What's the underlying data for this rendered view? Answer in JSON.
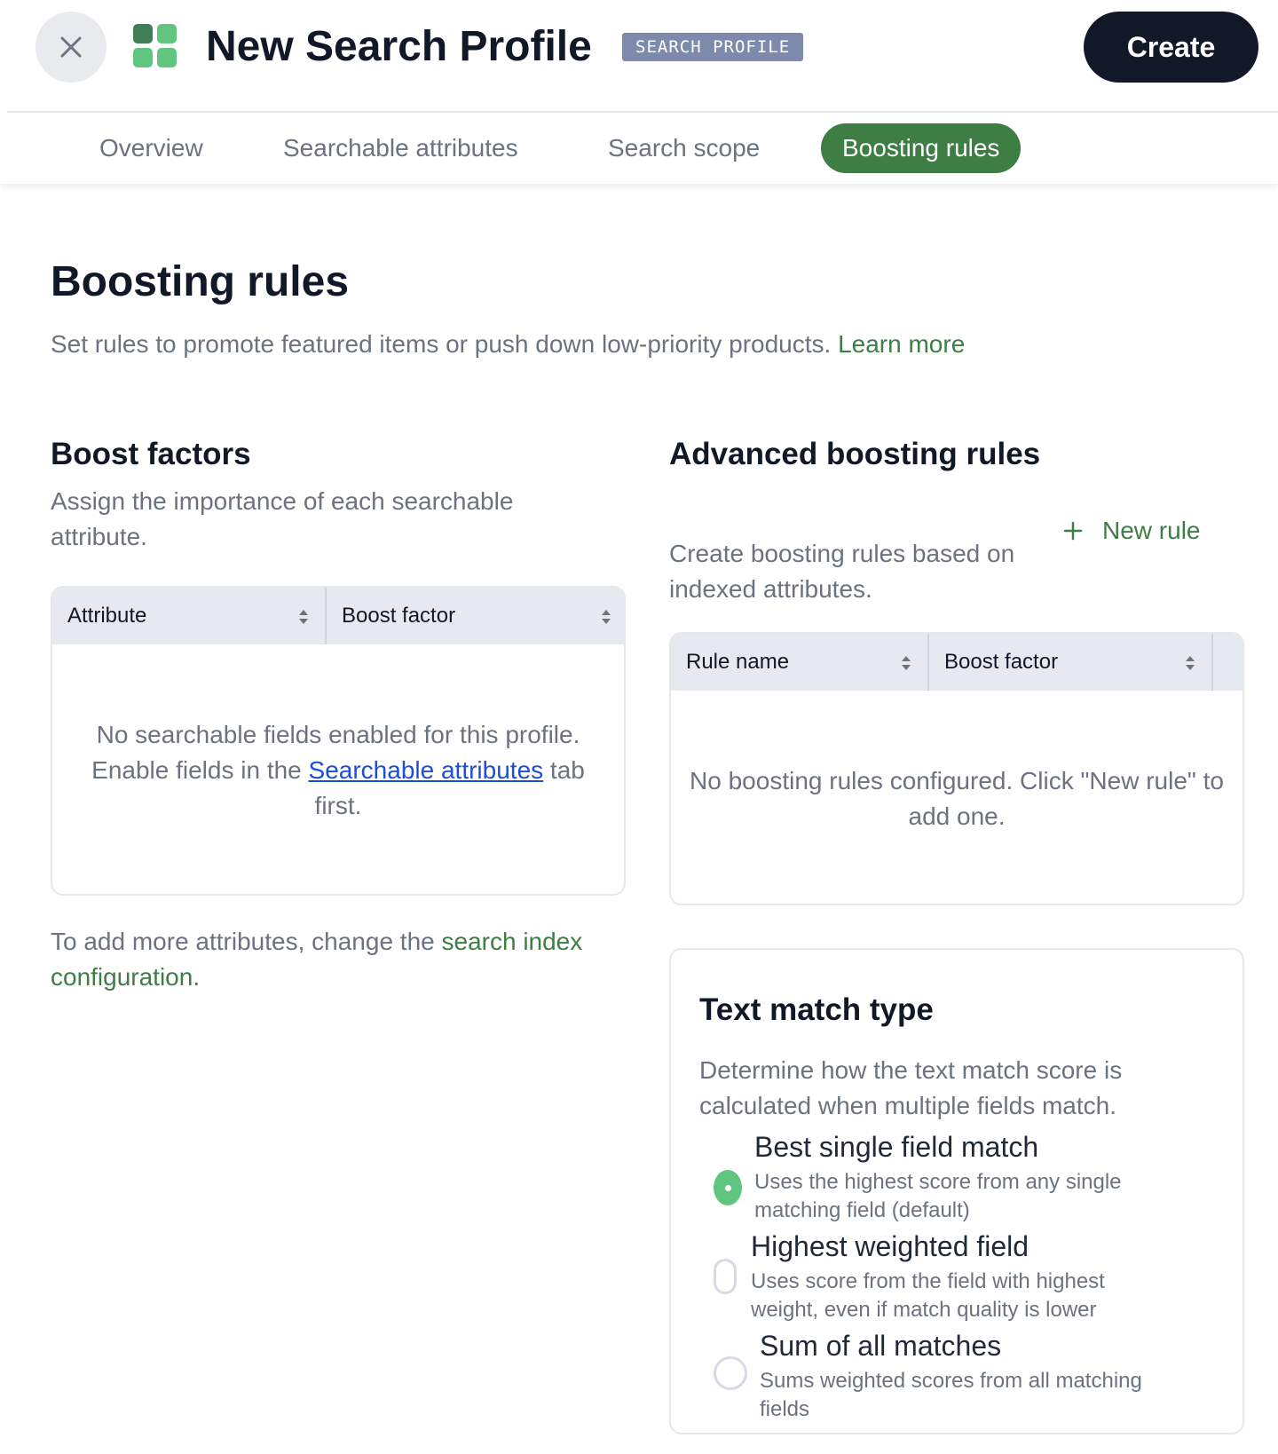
{
  "header": {
    "title": "New Search Profile",
    "badge": "SEARCH PROFILE",
    "create_label": "Create",
    "close_icon": "close-icon",
    "logo_icon": "grid-logo-icon"
  },
  "tabs": [
    {
      "label": "Overview",
      "active": false
    },
    {
      "label": "Searchable attributes",
      "active": false
    },
    {
      "label": "Search scope",
      "active": false
    },
    {
      "label": "Boosting rules",
      "active": true
    }
  ],
  "page": {
    "title": "Boosting rules",
    "description": "Set rules to promote featured items or push down low-priority products.",
    "learn_more": "Learn more"
  },
  "boost_factors": {
    "title": "Boost factors",
    "description": "Assign the importance of each searchable attribute.",
    "columns": [
      "Attribute",
      "Boost factor"
    ],
    "empty_before": "No searchable fields enabled for this profile. Enable fields in the",
    "empty_link": "Searchable attributes",
    "empty_after": "tab first.",
    "note_text": "To add more attributes, change the",
    "note_link": "search index configuration."
  },
  "advanced": {
    "title": "Advanced boosting rules",
    "description": "Create boosting rules based on indexed attributes.",
    "new_rule_label": "New rule",
    "columns": [
      "Rule name",
      "Boost factor"
    ],
    "empty_message": "No boosting rules configured. Click \"New rule\" to add one."
  },
  "text_match": {
    "title": "Text match type",
    "description": "Determine how the text match score is calculated when multiple fields match.",
    "options": [
      {
        "title": "Best single field match",
        "description": "Uses the highest score from any single matching field (default)",
        "selected": true
      },
      {
        "title": "Highest weighted field",
        "description": "Uses score from the field with highest weight, even if match quality is lower",
        "selected": false
      },
      {
        "title": "Sum of all matches",
        "description": "Sums weighted scores from all matching fields",
        "selected": false
      }
    ]
  },
  "colors": {
    "accent_green": "#3e7d44",
    "radio_green": "#5fc57f",
    "dark": "#111827",
    "badge_bg": "#7d8aab",
    "link_blue": "#1d4ed8"
  }
}
